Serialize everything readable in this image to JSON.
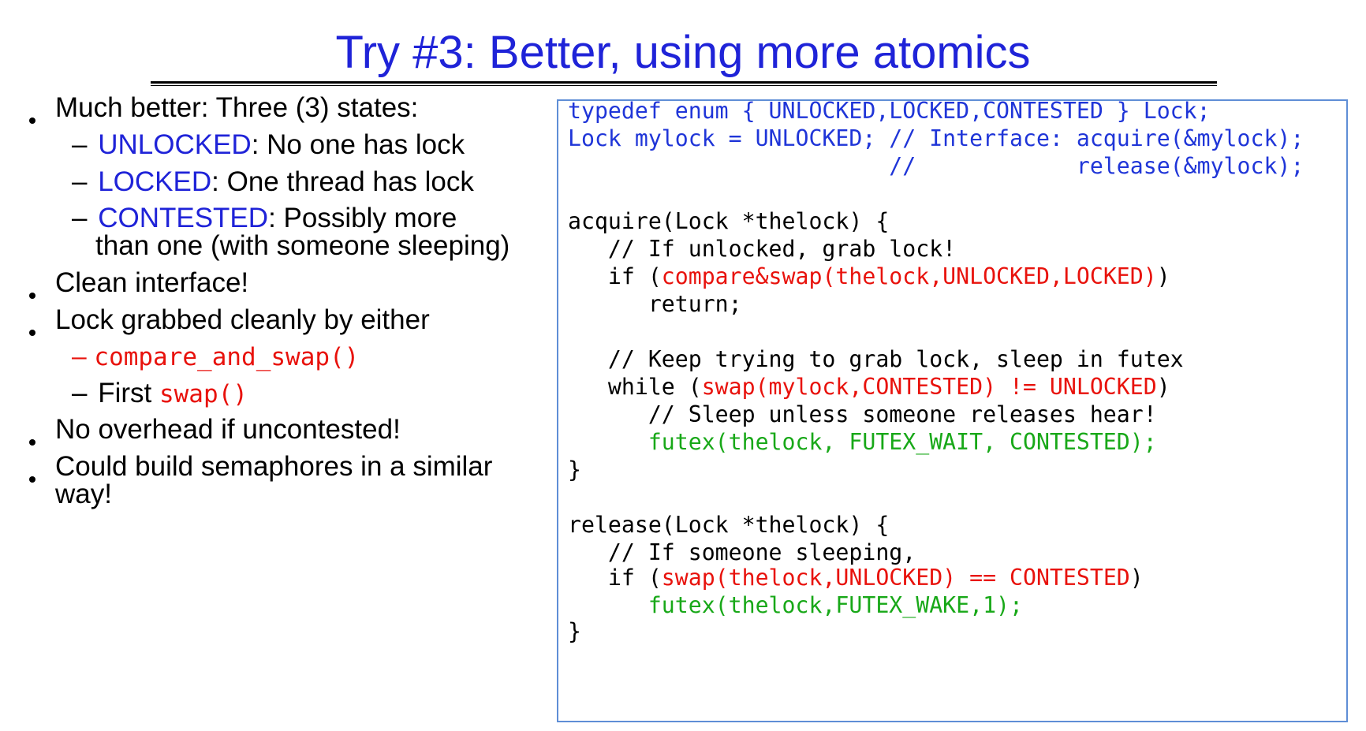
{
  "title": "Try #3: Better, using more atomics",
  "bullets": {
    "b1": "Much better: Three (3) states:",
    "b1_sub1_dash": "–",
    "b1_sub1_term": "UNLOCKED",
    "b1_sub1_rest": ": No one has lock",
    "b1_sub2_dash": "–",
    "b1_sub2_term": "LOCKED",
    "b1_sub2_rest": ": One thread has lock",
    "b1_sub3_dash": "–",
    "b1_sub3_term": "CONTESTED",
    "b1_sub3_rest": ": Possibly more",
    "b1_sub3_cont": "than one (with someone sleeping)",
    "b2": "Clean interface!",
    "b3": "Lock grabbed cleanly by either",
    "b3_sub1_dash": "–",
    "b3_sub1_code": "compare_and_swap()",
    "b3_sub2_dash": "–",
    "b3_sub2_text": "First ",
    "b3_sub2_code": "swap()",
    "b4": "No overhead if uncontested!",
    "b5_line1": "Could build semaphores in a similar",
    "b5_line2": "way!"
  },
  "code": {
    "l1": "typedef enum { UNLOCKED,LOCKED,CONTESTED } Lock;",
    "l2": "Lock mylock = UNLOCKED; // Interface: acquire(&mylock);",
    "l3": "                        //            release(&mylock);",
    "l5": "acquire(Lock *thelock) {",
    "l6": "   // If unlocked, grab lock!",
    "l7_a": "   if (",
    "l7_b": "compare&swap(thelock,UNLOCKED,LOCKED)",
    "l7_c": ")",
    "l8": "      return;",
    "l10": "   // Keep trying to grab lock, sleep in futex",
    "l11_a": "   while (",
    "l11_b": "swap(mylock,CONTESTED) != UNLOCKED",
    "l11_c": ")",
    "l12": "      // Sleep unless someone releases hear!",
    "l13": "      futex(thelock, FUTEX_WAIT, CONTESTED);",
    "l14": "}",
    "l16": "release(Lock *thelock) {",
    "l17": "   // If someone sleeping,",
    "l18_a": "   if (",
    "l18_b": "swap(thelock,UNLOCKED) == CONTESTED",
    "l18_c": ")",
    "l19": "      futex(thelock,FUTEX_WAKE,1);",
    "l20": "}"
  },
  "colors": {
    "title": "#1f23d8",
    "term_blue": "#1f23d8",
    "code_blue": "#1f35d8",
    "code_red": "#e8120c",
    "code_green": "#18a818",
    "box_border": "#5f8ed6"
  }
}
